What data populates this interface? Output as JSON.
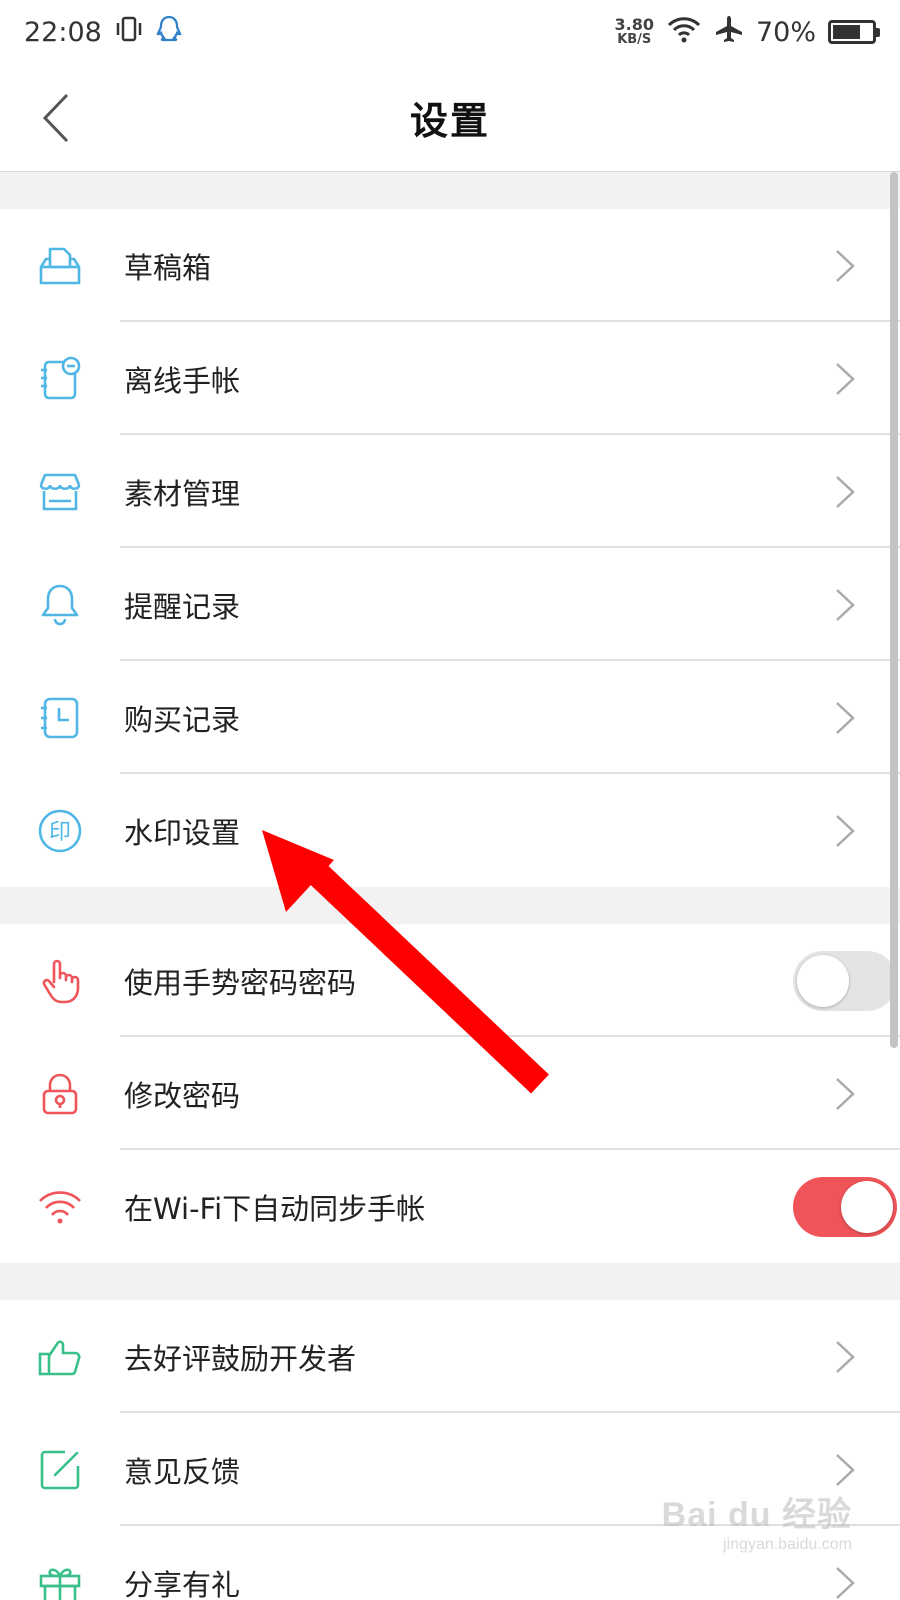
{
  "status_bar": {
    "time": "22:08",
    "speed_value": "3.80",
    "speed_unit": "KB/S",
    "battery": "70%",
    "battery_level": 0.7
  },
  "header": {
    "title": "设置"
  },
  "sections": [
    {
      "items": [
        {
          "label": "草稿箱",
          "icon": "inbox-tray-icon",
          "control": "chevron"
        },
        {
          "label": "离线手帐",
          "icon": "offline-notebook-icon",
          "control": "chevron"
        },
        {
          "label": "素材管理",
          "icon": "store-icon",
          "control": "chevron"
        },
        {
          "label": "提醒记录",
          "icon": "bell-icon",
          "control": "chevron"
        },
        {
          "label": "购买记录",
          "icon": "clock-notebook-icon",
          "control": "chevron"
        },
        {
          "label": "水印设置",
          "icon": "stamp-icon",
          "control": "chevron"
        }
      ]
    },
    {
      "items": [
        {
          "label": "使用手势密码密码",
          "icon": "hand-pointer-icon",
          "control": "toggle",
          "on": false
        },
        {
          "label": "修改密码",
          "icon": "lock-icon",
          "control": "chevron"
        },
        {
          "label": "在Wi-Fi下自动同步手帐",
          "icon": "wifi-icon",
          "control": "toggle",
          "on": true
        }
      ]
    },
    {
      "items": [
        {
          "label": "去好评鼓励开发者",
          "icon": "thumbs-up-icon",
          "control": "chevron"
        },
        {
          "label": "意见反馈",
          "icon": "edit-box-icon",
          "control": "chevron"
        },
        {
          "label": "分享有礼",
          "icon": "gift-icon",
          "control": "chevron"
        }
      ]
    }
  ],
  "icon_glyphs": {
    "stamp": "印"
  },
  "colors": {
    "blue": "#4fb6e6",
    "red": "#ef5458",
    "green": "#39c08a",
    "arrow": "#ff0000"
  },
  "watermark": {
    "main": "Bai du 经验",
    "sub": "jingyan.baidu.com"
  }
}
